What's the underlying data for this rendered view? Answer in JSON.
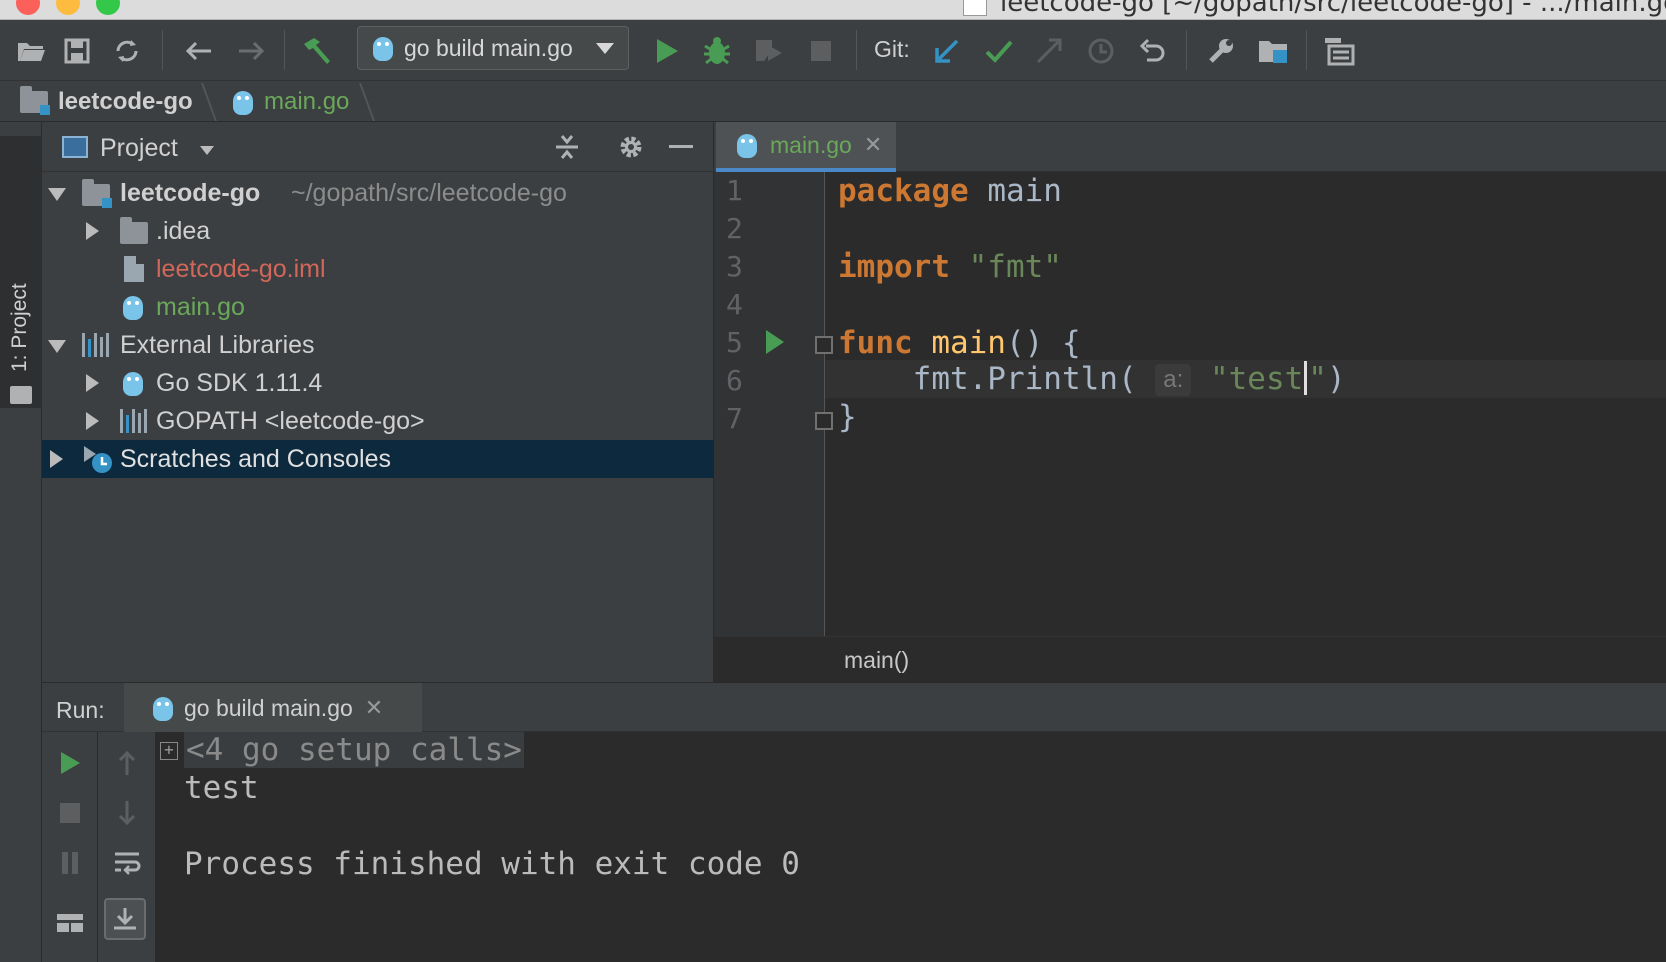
{
  "window": {
    "title": "leetcode-go [~/gopath/src/leetcode-go] - .../main.go [l"
  },
  "toolbar": {
    "run_config": "go build main.go",
    "git_label": "Git:"
  },
  "breadcrumb": {
    "project": "leetcode-go",
    "file": "main.go"
  },
  "left_strip": {
    "project_tab": "1: Project"
  },
  "project_panel": {
    "title": "Project",
    "tree": [
      {
        "label": "leetcode-go",
        "sublabel": "~/gopath/src/leetcode-go"
      },
      {
        "label": ".idea"
      },
      {
        "label": "leetcode-go.iml"
      },
      {
        "label": "main.go"
      },
      {
        "label": "External Libraries"
      },
      {
        "label": "Go SDK 1.11.4"
      },
      {
        "label": "GOPATH <leetcode-go>"
      },
      {
        "label": "Scratches and Consoles"
      }
    ]
  },
  "editor": {
    "tab": "main.go",
    "line_numbers": [
      "1",
      "2",
      "3",
      "4",
      "5",
      "6",
      "7"
    ],
    "lines": {
      "l1_kw": "package",
      "l1_rest": " main",
      "l3_kw": "import",
      "l3_str": " \"fmt\"",
      "l5_kw": "func",
      "l5_fn": " main",
      "l5_rest": "() {",
      "l6_a": "    fmt.Println( ",
      "l6_hint": "a:",
      "l6_str1": " \"test",
      "l6_str2": "\"",
      "l6_b": ")",
      "l7": "}"
    },
    "status_crumb": "main()"
  },
  "run_panel": {
    "label": "Run:",
    "tab": "go build main.go",
    "console": {
      "setup": "<4 go setup calls>",
      "output": "test",
      "exit": "Process finished with exit code 0"
    }
  },
  "colors": {
    "accent": "#4a88c7",
    "keyword": "#cc7832",
    "string": "#6a8759",
    "function": "#ffc66d",
    "file_modified": "#6aa85a",
    "file_untracked": "#d1675a",
    "selection": "#0d293e"
  }
}
